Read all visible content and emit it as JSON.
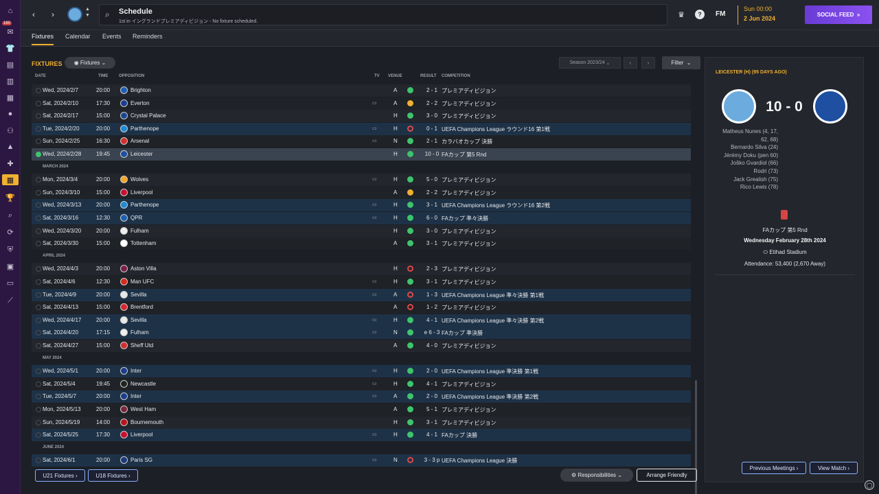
{
  "header": {
    "title": "Schedule",
    "subtitle": "1st in イングランドプレミアディビジョン - No fixture scheduled.",
    "fm_logo": "FM",
    "date_line1": "Sun 00:00",
    "date_line2": "2 Jun 2024",
    "social_feed": "SOCIAL FEED",
    "inbox_count": "160"
  },
  "tabs": [
    "Fixtures",
    "Calendar",
    "Events",
    "Reminders"
  ],
  "toolbar": {
    "section_title": "FIXTURES",
    "view_dropdown": "Fixtures",
    "season": "Season 2023/24",
    "filter": "Filter"
  },
  "columns": {
    "date": "DATE",
    "time": "TIME",
    "opposition": "OPPOSITION",
    "tv": "TV",
    "venue": "VENUE",
    "result": "RESULT",
    "competition": "COMPETITION"
  },
  "months": {
    "march": "MARCH 2024",
    "april": "APRIL 2024",
    "may": "MAY 2024",
    "june": "JUNE 2024"
  },
  "fixtures": [
    {
      "date": "Wed, 2024/2/7",
      "time": "20:00",
      "opp": "Brighton",
      "tv": "",
      "venue": "A",
      "outcome": "win",
      "result": "2 - 1",
      "comp": "プレミアディビジョン",
      "crest": "#1d5fb3",
      "style": "even"
    },
    {
      "date": "Sat, 2024/2/10",
      "time": "17:30",
      "opp": "Everton",
      "tv": "▭",
      "venue": "A",
      "outcome": "draw",
      "result": "2 - 2",
      "comp": "プレミアディビジョン",
      "crest": "#1b3d8f",
      "style": "odd"
    },
    {
      "date": "Sat, 2024/2/17",
      "time": "15:00",
      "opp": "Crystal Palace",
      "tv": "",
      "venue": "H",
      "outcome": "win",
      "result": "3 - 0",
      "comp": "プレミアディビジョン",
      "crest": "#1b458f",
      "style": "even"
    },
    {
      "date": "Tue, 2024/2/20",
      "time": "20:00",
      "opp": "Parthenope",
      "tv": "▭",
      "venue": "H",
      "outcome": "loss",
      "result": "0 - 1",
      "comp": "UEFA Champions League ラウンド16 第1戦",
      "crest": "#1f8ad6",
      "style": "ucl"
    },
    {
      "date": "Sun, 2024/2/25",
      "time": "16:30",
      "opp": "Arsenal",
      "tv": "▭",
      "venue": "N",
      "outcome": "win",
      "result": "2 - 1",
      "comp": "カラバオカップ 決勝",
      "crest": "#d32f2f",
      "style": "odd"
    },
    {
      "date": "Wed, 2024/2/28",
      "time": "19:45",
      "opp": "Leicester",
      "tv": "",
      "venue": "H",
      "outcome": "win",
      "result": "10 - 0",
      "comp": "FAカップ 第5 Rnd",
      "crest": "#1e4fa0",
      "style": "hl"
    },
    {
      "date": "Mon, 2024/3/4",
      "time": "20:00",
      "opp": "Wolves",
      "tv": "▭",
      "venue": "H",
      "outcome": "win",
      "result": "5 - 0",
      "comp": "プレミアディビジョン",
      "crest": "#f5a623",
      "style": "even"
    },
    {
      "date": "Sun, 2024/3/10",
      "time": "15:00",
      "opp": "Liverpool",
      "tv": "",
      "venue": "A",
      "outcome": "draw",
      "result": "2 - 2",
      "comp": "プレミアディビジョン",
      "crest": "#c8102e",
      "style": "odd"
    },
    {
      "date": "Wed, 2024/3/13",
      "time": "20:00",
      "opp": "Parthenope",
      "tv": "▭",
      "venue": "H",
      "outcome": "win",
      "result": "3 - 1",
      "comp": "UEFA Champions League ラウンド16 第2戦",
      "crest": "#1f8ad6",
      "style": "ucl"
    },
    {
      "date": "Sat, 2024/3/16",
      "time": "12:30",
      "opp": "QPR",
      "tv": "▭",
      "venue": "H",
      "outcome": "win",
      "result": "6 - 0",
      "comp": "FAカップ 準々決勝",
      "crest": "#1d5fb3",
      "style": "ucl"
    },
    {
      "date": "Wed, 2024/3/20",
      "time": "20:00",
      "opp": "Fulham",
      "tv": "",
      "venue": "H",
      "outcome": "win",
      "result": "3 - 0",
      "comp": "プレミアディビジョン",
      "crest": "#eeeeee",
      "style": "even"
    },
    {
      "date": "Sat, 2024/3/30",
      "time": "15:00",
      "opp": "Tottenham",
      "tv": "",
      "venue": "A",
      "outcome": "win",
      "result": "3 - 1",
      "comp": "プレミアディビジョン",
      "crest": "#ffffff",
      "style": "odd"
    },
    {
      "date": "Wed, 2024/4/3",
      "time": "20:00",
      "opp": "Aston Villa",
      "tv": "",
      "venue": "H",
      "outcome": "loss",
      "result": "2 - 3",
      "comp": "プレミアディビジョン",
      "crest": "#7a1e4a",
      "style": "even"
    },
    {
      "date": "Sat, 2024/4/6",
      "time": "12:30",
      "opp": "Man UFC",
      "tv": "▭",
      "venue": "H",
      "outcome": "win",
      "result": "3 - 1",
      "comp": "プレミアディビジョン",
      "crest": "#d62a1f",
      "style": "odd"
    },
    {
      "date": "Tue, 2024/4/9",
      "time": "20:00",
      "opp": "Sevilla",
      "tv": "▭",
      "venue": "A",
      "outcome": "loss",
      "result": "1 - 3",
      "comp": "UEFA Champions League 準々決勝 第1戦",
      "crest": "#e8e8e8",
      "style": "ucl"
    },
    {
      "date": "Sat, 2024/4/13",
      "time": "15:00",
      "opp": "Brentford",
      "tv": "",
      "venue": "A",
      "outcome": "loss",
      "result": "1 - 2",
      "comp": "プレミアディビジョン",
      "crest": "#d9262e",
      "style": "odd"
    },
    {
      "date": "Wed, 2024/4/17",
      "time": "20:00",
      "opp": "Sevilla",
      "tv": "▭",
      "venue": "H",
      "outcome": "win",
      "result": "4 - 1",
      "comp": "UEFA Champions League 準々決勝 第2戦",
      "crest": "#e8e8e8",
      "style": "ucl"
    },
    {
      "date": "Sat, 2024/4/20",
      "time": "17:15",
      "opp": "Fulham",
      "tv": "▭",
      "venue": "N",
      "outcome": "win",
      "result": "e 6 - 3",
      "comp": "FAカップ 準決勝",
      "crest": "#eeeeee",
      "style": "ucl"
    },
    {
      "date": "Sat, 2024/4/27",
      "time": "15:00",
      "opp": "Sheff Utd",
      "tv": "",
      "venue": "A",
      "outcome": "win",
      "result": "4 - 0",
      "comp": "プレミアディビジョン",
      "crest": "#d32f2f",
      "style": "even"
    },
    {
      "date": "Wed, 2024/5/1",
      "time": "20:00",
      "opp": "Inter",
      "tv": "▭",
      "venue": "H",
      "outcome": "win",
      "result": "2 - 0",
      "comp": "UEFA Champions League 準決勝 第1戦",
      "crest": "#1a3e8c",
      "style": "ucl"
    },
    {
      "date": "Sat, 2024/5/4",
      "time": "19:45",
      "opp": "Newcastle",
      "tv": "▭",
      "venue": "H",
      "outcome": "win",
      "result": "4 - 1",
      "comp": "プレミアディビジョン",
      "crest": "#222222",
      "style": "odd"
    },
    {
      "date": "Tue, 2024/5/7",
      "time": "20:00",
      "opp": "Inter",
      "tv": "▭",
      "venue": "A",
      "outcome": "win",
      "result": "2 - 0",
      "comp": "UEFA Champions League 準決勝 第2戦",
      "crest": "#1a3e8c",
      "style": "ucl"
    },
    {
      "date": "Mon, 2024/5/13",
      "time": "20:00",
      "opp": "West Ham",
      "tv": "",
      "venue": "A",
      "outcome": "win",
      "result": "5 - 1",
      "comp": "プレミアディビジョン",
      "crest": "#7a263a",
      "style": "odd"
    },
    {
      "date": "Sun, 2024/5/19",
      "time": "14:00",
      "opp": "Bournemouth",
      "tv": "",
      "venue": "H",
      "outcome": "win",
      "result": "3 - 1",
      "comp": "プレミアディビジョン",
      "crest": "#b8151b",
      "style": "even"
    },
    {
      "date": "Sat, 2024/5/25",
      "time": "17:30",
      "opp": "Liverpool",
      "tv": "▭",
      "venue": "H",
      "outcome": "win",
      "result": "4 - 1",
      "comp": "FAカップ 決勝",
      "crest": "#c8102e",
      "style": "ucl"
    },
    {
      "date": "Sat, 2024/6/1",
      "time": "20:00",
      "opp": "Paris SG",
      "tv": "▭",
      "venue": "N",
      "outcome": "loss",
      "result": "3 - 3 p",
      "comp": "UEFA Champions League 決勝",
      "crest": "#1b3a7a",
      "style": "ucl"
    }
  ],
  "bottom_buttons": {
    "u21": "U21 Fixtures",
    "u18": "U18 Fixtures",
    "responsibilities": "Responsibilities",
    "arrange": "Arrange Friendly"
  },
  "match_panel": {
    "heading": "LEICESTER (H) (95 DAYS AGO)",
    "score": "10 - 0",
    "scorers": [
      "Matheus Nunes (4, 17,",
      "62, 68)",
      "Bernardo Silva (24)",
      "Jérémy Doku (pen 60)",
      "Joško Gvardiol (66)",
      "Rodri (73)",
      "Jack Grealish (75)",
      "Rico Lewis (78)"
    ],
    "competition": "FAカップ 第5 Rnd",
    "date": "Wednesday February 28th 2024",
    "stadium": "Etihad Stadium",
    "attendance": "Attendance: 53,400 (2,670 Away)",
    "prev_meetings": "Previous Meetings",
    "view_match": "View Match"
  },
  "colors": {
    "accent": "#f0b030",
    "win": "#3ec46d",
    "draw": "#f0b030",
    "loss": "#e04848",
    "man_city": "#6cabdd",
    "leicester": "#1e4fa0"
  }
}
